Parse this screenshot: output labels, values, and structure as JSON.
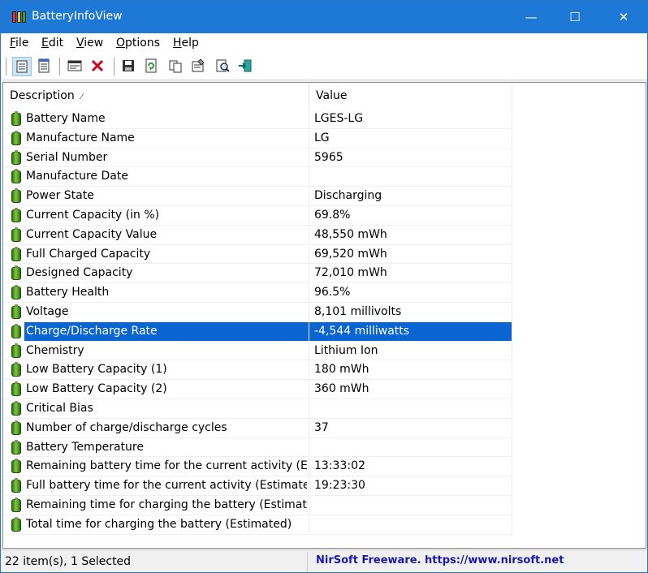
{
  "window": {
    "title": "BatteryInfoView",
    "minimize": "—",
    "maximize": "☐",
    "close": "✕"
  },
  "menu": {
    "items": [
      {
        "label_ul": "F",
        "label_rest": "ile"
      },
      {
        "label_ul": "E",
        "label_rest": "dit"
      },
      {
        "label_ul": "V",
        "label_rest": "iew"
      },
      {
        "label_ul": "O",
        "label_rest": "ptions"
      },
      {
        "label_ul": "H",
        "label_rest": "elp"
      }
    ]
  },
  "toolbar": {
    "icons": [
      "battery-info-mode-icon",
      "battery-log-mode-icon",
      "html-report-icon",
      "delete-icon",
      "save-icon",
      "refresh-icon",
      "copy-icon",
      "properties-icon",
      "find-icon",
      "exit-icon"
    ]
  },
  "columns": {
    "description": "Description",
    "value": "Value"
  },
  "rows": [
    {
      "desc": "Battery Name",
      "value": "LGES-LG"
    },
    {
      "desc": "Manufacture Name",
      "value": " LG"
    },
    {
      "desc": "Serial Number",
      "value": "5965"
    },
    {
      "desc": "Manufacture Date",
      "value": ""
    },
    {
      "desc": "Power State",
      "value": "Discharging"
    },
    {
      "desc": "Current Capacity (in %)",
      "value": "69.8%"
    },
    {
      "desc": "Current Capacity Value",
      "value": "48,550 mWh"
    },
    {
      "desc": "Full Charged Capacity",
      "value": "69,520 mWh"
    },
    {
      "desc": "Designed Capacity",
      "value": "72,010 mWh"
    },
    {
      "desc": "Battery Health",
      "value": "96.5%"
    },
    {
      "desc": "Voltage",
      "value": "8,101 millivolts"
    },
    {
      "desc": "Charge/Discharge Rate",
      "value": "-4,544 milliwatts"
    },
    {
      "desc": "Chemistry",
      "value": "Lithium Ion"
    },
    {
      "desc": "Low Battery Capacity (1)",
      "value": "180 mWh"
    },
    {
      "desc": "Low Battery Capacity (2)",
      "value": "360 mWh"
    },
    {
      "desc": "Critical Bias",
      "value": ""
    },
    {
      "desc": "Number of charge/discharge cycles",
      "value": "37"
    },
    {
      "desc": "Battery Temperature",
      "value": ""
    },
    {
      "desc": "Remaining battery time for the current activity (Esti...",
      "value": "13:33:02"
    },
    {
      "desc": "Full battery time for the current activity (Estimated)",
      "value": "19:23:30"
    },
    {
      "desc": "Remaining time for charging the battery (Estimated)",
      "value": ""
    },
    {
      "desc": "Total  time for charging the battery (Estimated)",
      "value": ""
    }
  ],
  "selected_index": 11,
  "status": {
    "count": "22 item(s), 1 Selected",
    "link": "NirSoft Freeware. https://www.nirsoft.net"
  },
  "colors": {
    "titlebar": "#1e78d6",
    "selection": "#0a64d2",
    "link": "#1a1aaa"
  }
}
